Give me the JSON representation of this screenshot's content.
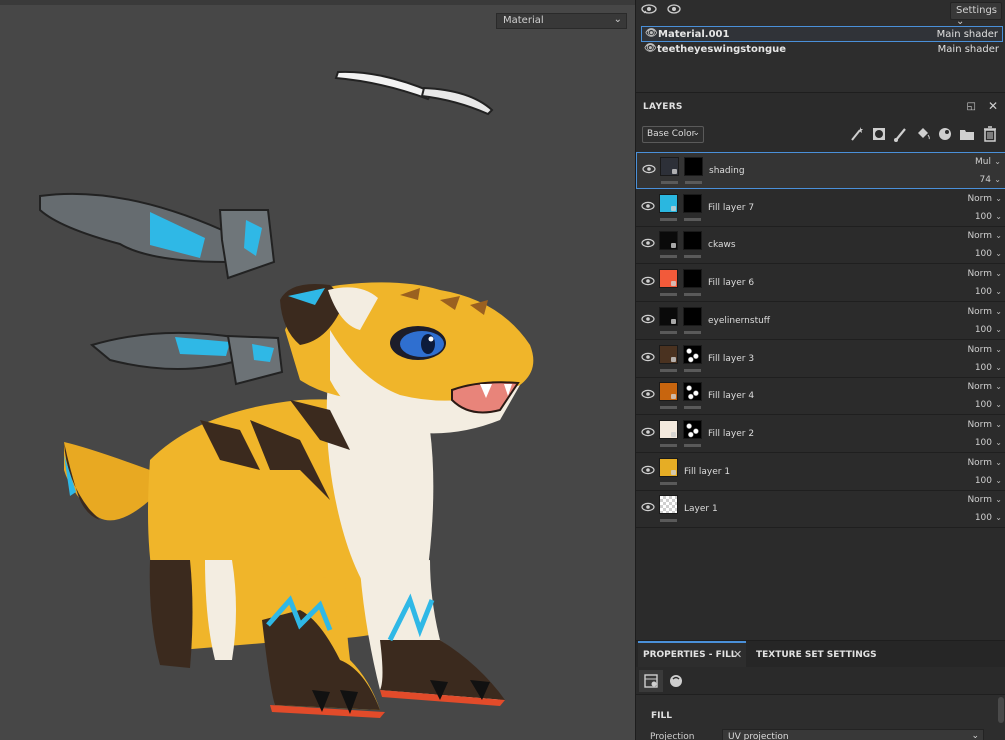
{
  "viewport": {
    "material_dropdown": "Material"
  },
  "texture_sets": {
    "settings_label": "Settings",
    "items": [
      {
        "name": "Material.001",
        "shader": "Main shader",
        "selected": true
      },
      {
        "name": "teetheyeswingstongue",
        "shader": "Main shader",
        "selected": false
      }
    ]
  },
  "layers": {
    "title": "LAYERS",
    "channel": "Base Color",
    "items": [
      {
        "name": "shading",
        "blend": "Mul",
        "opacity": "74",
        "thumb_color": "#2d3038",
        "selected": true
      },
      {
        "name": "Fill layer 7",
        "blend": "Norm",
        "opacity": "100",
        "thumb_color": "#2ab7e0"
      },
      {
        "name": "ckaws",
        "blend": "Norm",
        "opacity": "100",
        "thumb_color": "#0a0a0a"
      },
      {
        "name": "Fill layer 6",
        "blend": "Norm",
        "opacity": "100",
        "thumb_color": "#f25a3a"
      },
      {
        "name": "eyelinernstuff",
        "blend": "Norm",
        "opacity": "100",
        "thumb_color": "#0a0a0a"
      },
      {
        "name": "Fill layer 3",
        "blend": "Norm",
        "opacity": "100",
        "thumb_color": "#4a3220"
      },
      {
        "name": "Fill layer 4",
        "blend": "Norm",
        "opacity": "100",
        "thumb_color": "#c8650e"
      },
      {
        "name": "Fill layer 2",
        "blend": "Norm",
        "opacity": "100",
        "thumb_color": "#f3e9dd"
      },
      {
        "name": "Fill layer 1",
        "blend": "Norm",
        "opacity": "100",
        "thumb_color": "#e6ad25"
      },
      {
        "name": "Layer 1",
        "blend": "Norm",
        "opacity": "100",
        "thumb_color": "checker"
      }
    ]
  },
  "properties": {
    "tab_fill": "PROPERTIES - FILL",
    "tab_texture": "TEXTURE SET SETTINGS",
    "section": "FILL",
    "projection_label": "Projection",
    "projection_value": "UV projection"
  },
  "colors": {
    "accent": "#4a90d9",
    "viewport_bg": "#474747",
    "panel_bg": "#2b2b2b"
  }
}
